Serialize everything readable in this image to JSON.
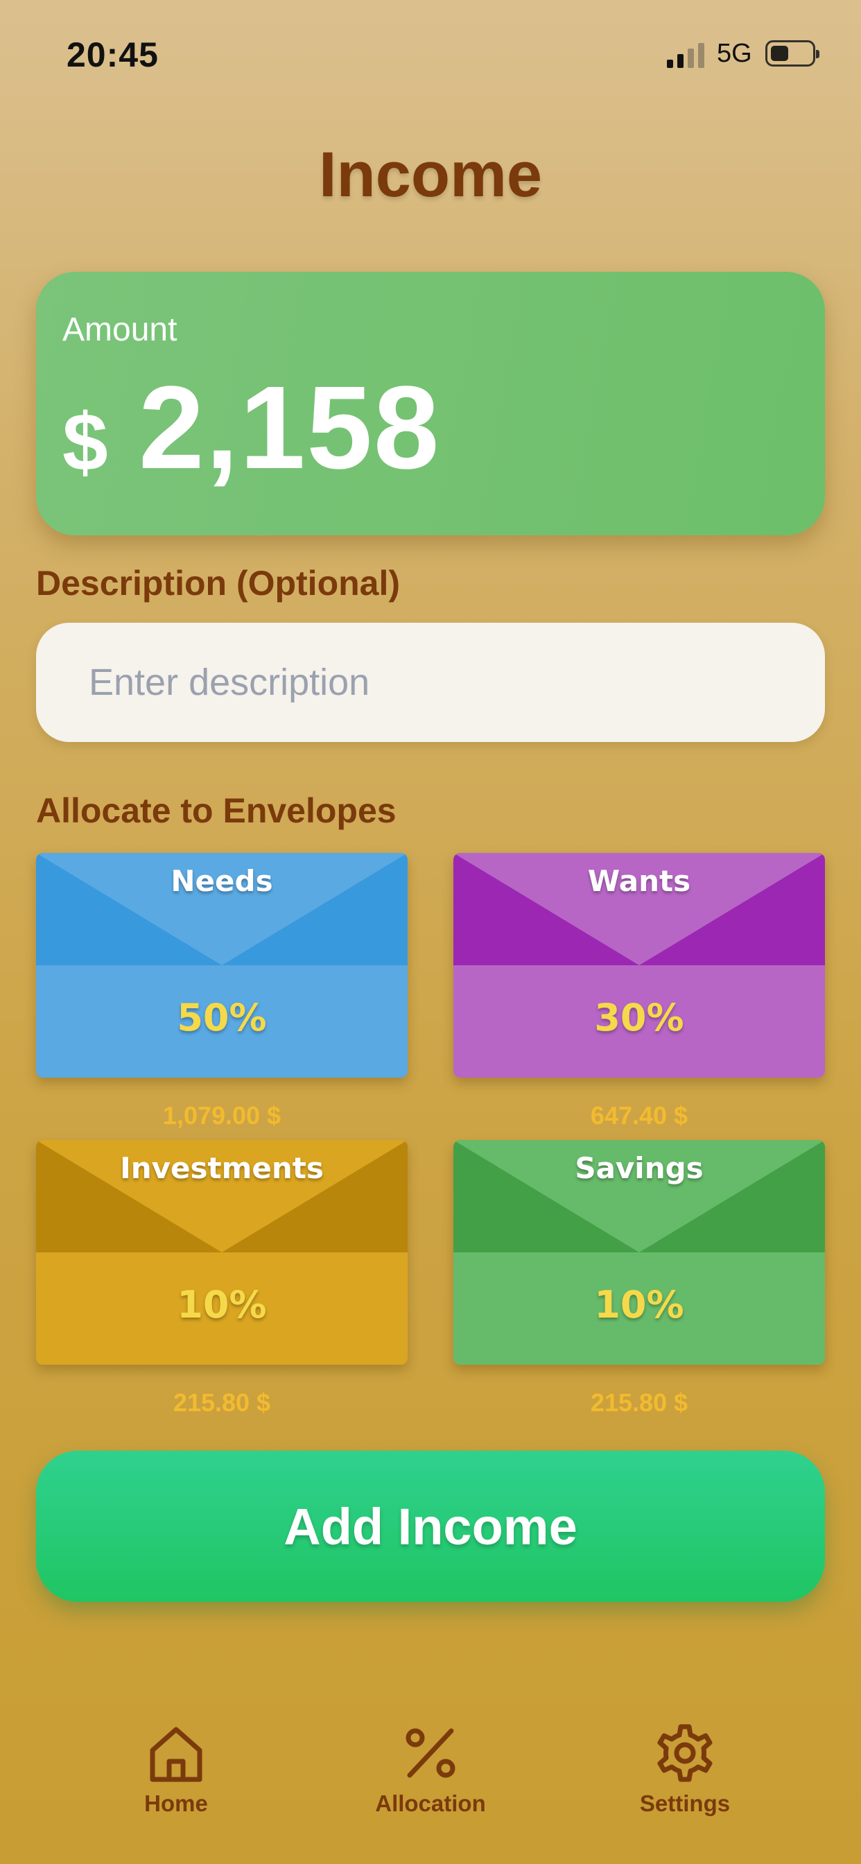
{
  "status_bar": {
    "time": "20:45",
    "network": "5G",
    "battery_level": 0.45
  },
  "page": {
    "title": "Income"
  },
  "amount_card": {
    "label": "Amount",
    "currency_symbol": "$",
    "value": "2,158",
    "color": "#72c271"
  },
  "description": {
    "label": "Description (Optional)",
    "placeholder": "Enter description",
    "value": ""
  },
  "allocation": {
    "label": "Allocate to Envelopes",
    "envelopes": [
      {
        "name": "Needs",
        "percent": "50%",
        "amount": "1,079.00 $",
        "body_color": "#5aa9e3",
        "flap_color": "#3899dc"
      },
      {
        "name": "Wants",
        "percent": "30%",
        "amount": "647.40 $",
        "body_color": "#b766c6",
        "flap_color": "#9c27b2"
      },
      {
        "name": "Investments",
        "percent": "10%",
        "amount": "215.80 $",
        "body_color": "#daa520",
        "flap_color": "#b8860b"
      },
      {
        "name": "Savings",
        "percent": "10%",
        "amount": "215.80 $",
        "body_color": "#66bb6a",
        "flap_color": "#43a047"
      }
    ]
  },
  "add_button": {
    "label": "Add Income",
    "color": "#26c975"
  },
  "tab_bar": {
    "items": [
      {
        "label": "Home",
        "icon": "home-icon"
      },
      {
        "label": "Allocation",
        "icon": "percent-icon"
      },
      {
        "label": "Settings",
        "icon": "gear-icon"
      }
    ]
  }
}
